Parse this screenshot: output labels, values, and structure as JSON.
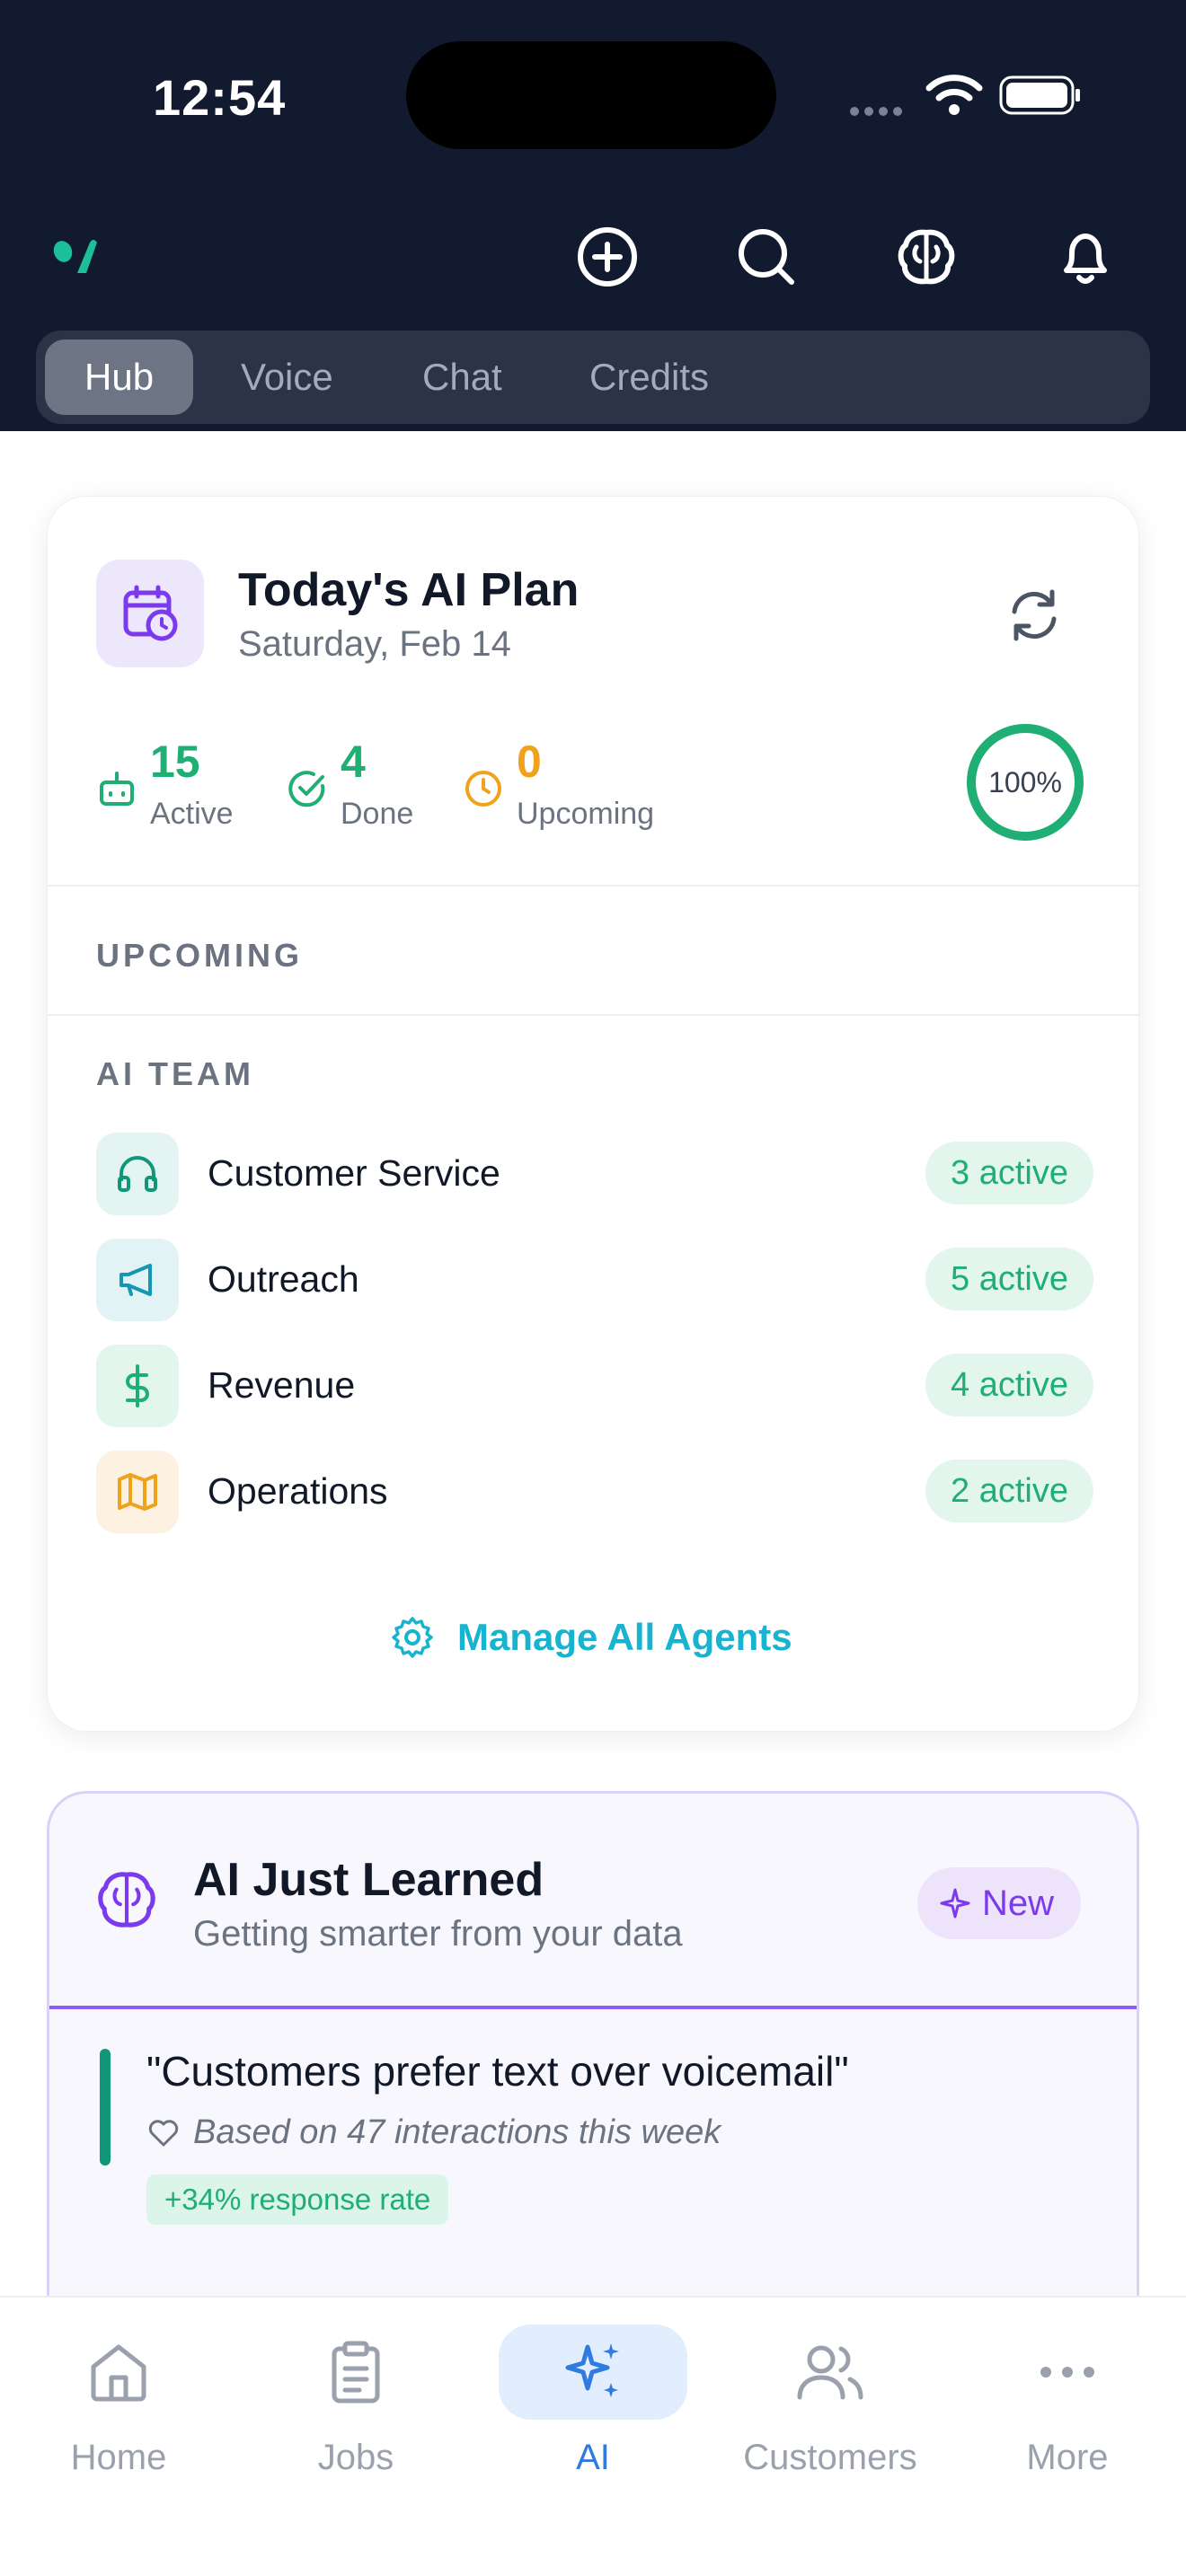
{
  "status_bar": {
    "time": "12:54"
  },
  "header": {
    "icons": [
      "add-circle-icon",
      "search-icon",
      "brain-icon",
      "bell-icon"
    ]
  },
  "segments": [
    "Hub",
    "Voice",
    "Chat",
    "Credits"
  ],
  "active_segment": "Hub",
  "plan": {
    "title": "Today's AI Plan",
    "date": "Saturday, Feb 14",
    "stats": [
      {
        "value": "15",
        "label": "Active",
        "color": "#1fae73",
        "icon": "robot-icon"
      },
      {
        "value": "4",
        "label": "Done",
        "color": "#1fae73",
        "icon": "check-circle-icon"
      },
      {
        "value": "0",
        "label": "Upcoming",
        "color": "#f0a21a",
        "icon": "clock-icon"
      }
    ],
    "progress_label": "100%",
    "progress_value": 1.0,
    "upcoming_label": "UPCOMING",
    "team_label": "AI TEAM",
    "agents": [
      {
        "name": "Customer Service",
        "badge": "3 active",
        "icon": "headphones-icon",
        "bg": "#e4f4f2",
        "fg": "#10977a"
      },
      {
        "name": "Outreach",
        "badge": "5 active",
        "icon": "megaphone-icon",
        "bg": "#e2f3f6",
        "fg": "#1596b3"
      },
      {
        "name": "Revenue",
        "badge": "4 active",
        "icon": "dollar-icon",
        "bg": "#e3f6ee",
        "fg": "#1fae73"
      },
      {
        "name": "Operations",
        "badge": "2 active",
        "icon": "map-icon",
        "bg": "#fdf2e2",
        "fg": "#f0a21a"
      }
    ],
    "manage_label": "Manage All Agents"
  },
  "learned": {
    "title": "AI Just Learned",
    "subtitle": "Getting smarter from your data",
    "badge": "New",
    "insight": {
      "quote": "\"Customers prefer text over voicemail\"",
      "basis": "Based on 47 interactions this week",
      "impact": "+34% response rate"
    }
  },
  "tabbar": [
    {
      "label": "Home",
      "icon": "home-icon"
    },
    {
      "label": "Jobs",
      "icon": "clipboard-icon"
    },
    {
      "label": "AI",
      "icon": "sparkles-icon",
      "active": true
    },
    {
      "label": "Customers",
      "icon": "users-icon"
    },
    {
      "label": "More",
      "icon": "more-dots-icon"
    }
  ]
}
